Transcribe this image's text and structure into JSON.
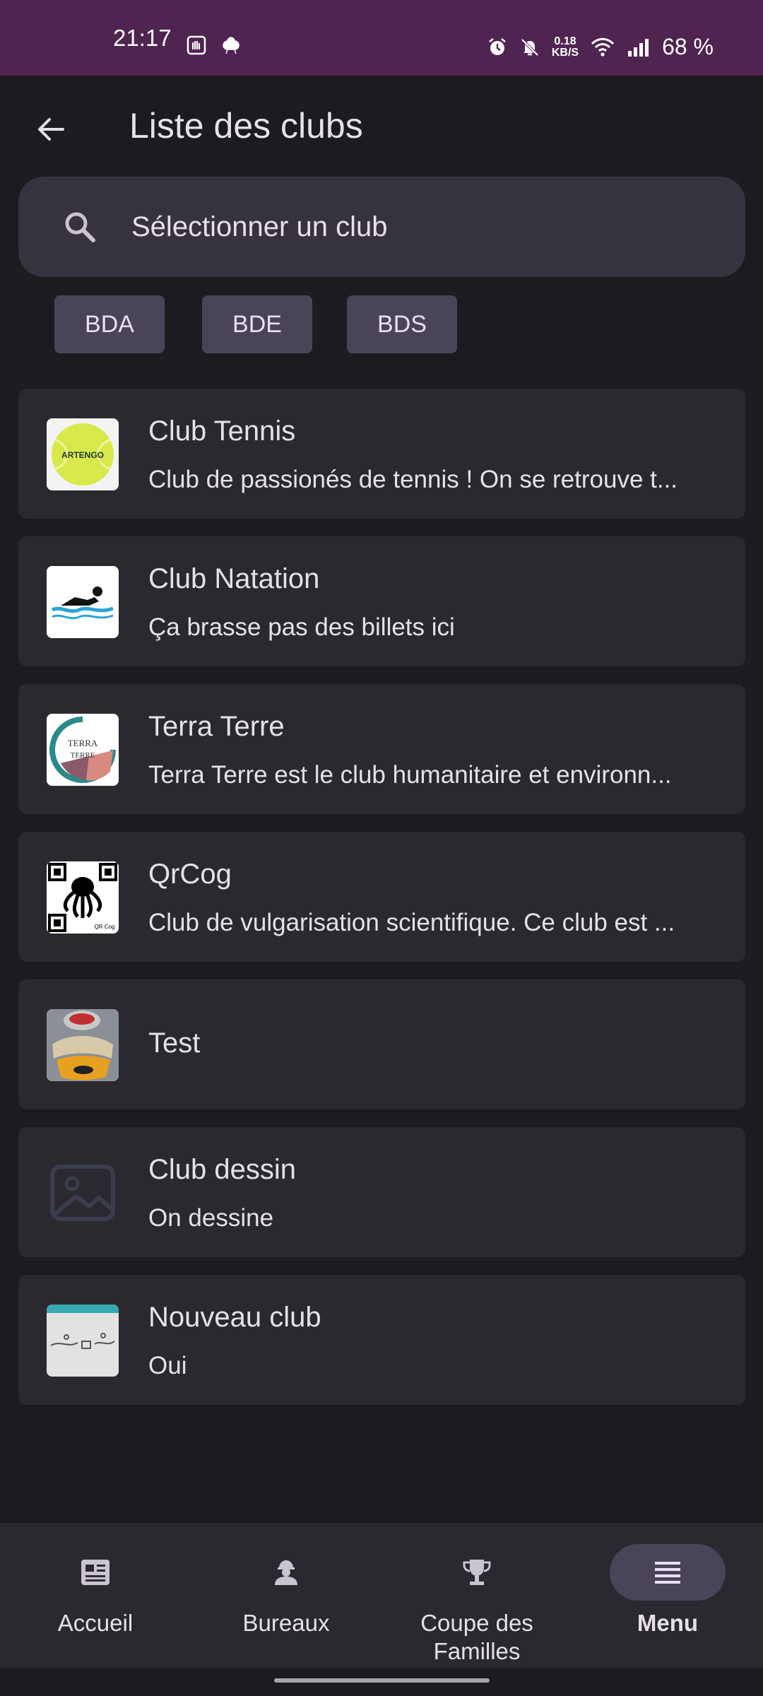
{
  "status_bar": {
    "time": "21:17",
    "net_speed_top": "0.18",
    "net_speed_bottom": "KB/S",
    "battery": "68 %"
  },
  "header": {
    "title": "Liste des clubs"
  },
  "search": {
    "placeholder": "Sélectionner un club"
  },
  "filters": [
    {
      "label": "BDA"
    },
    {
      "label": "BDE"
    },
    {
      "label": "BDS"
    }
  ],
  "clubs": [
    {
      "name": "Club Tennis",
      "description": "Club de passionés de tennis ! On se retrouve t...",
      "logo": "tennis-ball-logo"
    },
    {
      "name": "Club Natation",
      "description": "Ça brasse pas des billets ici",
      "logo": "swimmer-logo"
    },
    {
      "name": "Terra Terre",
      "description": "Terra Terre est le club humanitaire et environn...",
      "logo": "terra-terre-logo"
    },
    {
      "name": "QrCog",
      "description": "Club de vulgarisation scientifique. Ce club est ...",
      "logo": "qrcog-logo",
      "logo_caption": "QR Cog"
    },
    {
      "name": "Test",
      "description": "",
      "logo": "photo-logo"
    },
    {
      "name": "Club dessin",
      "description": "On dessine",
      "logo": "image-placeholder-icon"
    },
    {
      "name": "Nouveau club",
      "description": "Oui",
      "logo": "whiteboard-photo-logo"
    }
  ],
  "logo_texts": {
    "tennis": "ARTENGO",
    "terra_top": "TERRA",
    "terra_bottom": "TERRE"
  },
  "bottom_nav": [
    {
      "label": "Accueil",
      "icon": "newspaper-icon"
    },
    {
      "label": "Bureaux",
      "icon": "worker-icon"
    },
    {
      "label": "Coupe des Familles",
      "icon": "trophy-icon"
    },
    {
      "label": "Menu",
      "icon": "menu-icon",
      "active": true
    }
  ],
  "colors": {
    "status_bar": "#4f2450",
    "background": "#1c1b1f",
    "card": "#2b2930",
    "chip": "#4a4458"
  }
}
